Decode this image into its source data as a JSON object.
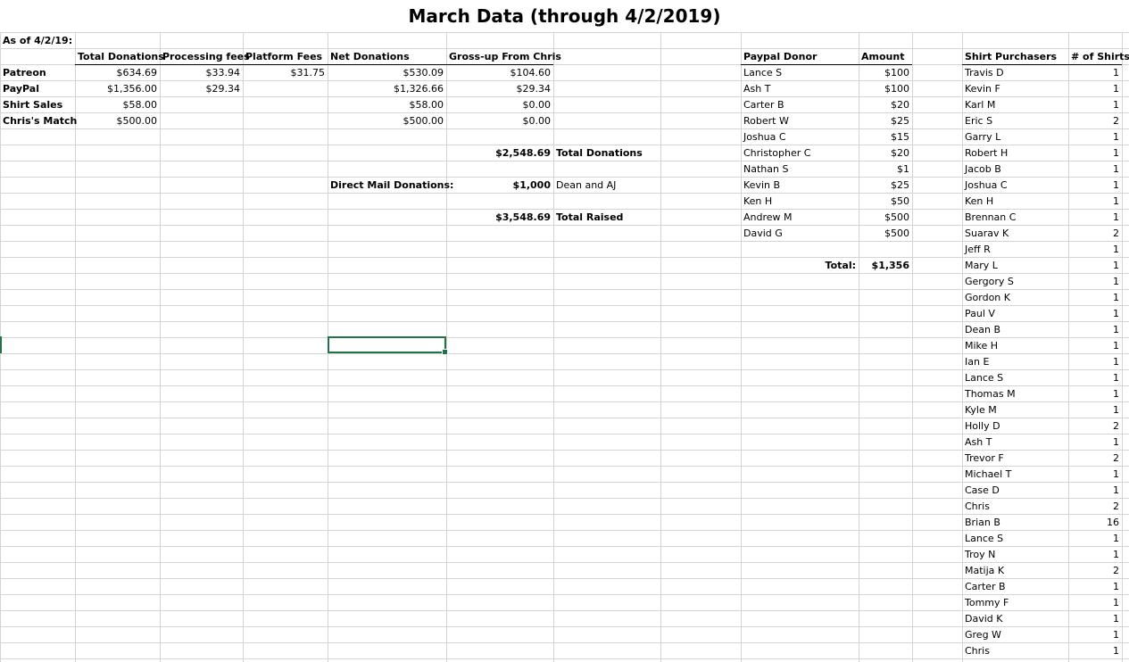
{
  "title": "March Data (through 4/2/2019)",
  "as_of": "As of 4/2/19:",
  "summary": {
    "headers": [
      "Total Donations",
      "Processing fees",
      "Platform Fees",
      "Net Donations",
      "Gross-up From Chris"
    ],
    "rows": [
      {
        "label": "Patreon",
        "total": "$634.69",
        "processing": "$33.94",
        "platform": "$31.75",
        "net": "$530.09",
        "grossup": "$104.60"
      },
      {
        "label": "PayPal",
        "total": "$1,356.00",
        "processing": "$29.34",
        "platform": "",
        "net": "$1,326.66",
        "grossup": "$29.34"
      },
      {
        "label": "Shirt Sales",
        "total": "$58.00",
        "processing": "",
        "platform": "",
        "net": "$58.00",
        "grossup": "$0.00"
      },
      {
        "label": "Chris's Match",
        "total": "$500.00",
        "processing": "",
        "platform": "",
        "net": "$500.00",
        "grossup": "$0.00"
      }
    ],
    "total_donations_value": "$2,548.69",
    "total_donations_label": "Total Donations",
    "direct_mail_label": "Direct Mail Donations:",
    "direct_mail_value": "$1,000",
    "direct_mail_note": "Dean and AJ",
    "total_raised_value": "$3,548.69",
    "total_raised_label": "Total Raised"
  },
  "paypal": {
    "header_donor": "Paypal Donor",
    "header_amount": "Amount",
    "donors": [
      {
        "name": "Lance S",
        "amount": "$100"
      },
      {
        "name": "Ash T",
        "amount": "$100"
      },
      {
        "name": "Carter B",
        "amount": "$20"
      },
      {
        "name": "Robert W",
        "amount": "$25"
      },
      {
        "name": "Joshua C",
        "amount": "$15"
      },
      {
        "name": "Christopher C",
        "amount": "$20"
      },
      {
        "name": "Nathan S",
        "amount": "$1"
      },
      {
        "name": "Kevin B",
        "amount": "$25"
      },
      {
        "name": "Ken H",
        "amount": "$50"
      },
      {
        "name": "Andrew M",
        "amount": "$500"
      },
      {
        "name": "David G",
        "amount": "$500"
      }
    ],
    "total_label": "Total:",
    "total_value": "$1,356"
  },
  "shirts": {
    "header_name": "Shirt Purchasers",
    "header_count": "# of Shirts",
    "purchasers": [
      {
        "name": "Travis D",
        "count": "1"
      },
      {
        "name": "Kevin F",
        "count": "1"
      },
      {
        "name": "Karl M",
        "count": "1"
      },
      {
        "name": "Eric S",
        "count": "2"
      },
      {
        "name": "Garry L",
        "count": "1"
      },
      {
        "name": "Robert H",
        "count": "1"
      },
      {
        "name": "Jacob B",
        "count": "1"
      },
      {
        "name": "Joshua C",
        "count": "1"
      },
      {
        "name": "Ken H",
        "count": "1"
      },
      {
        "name": "Brennan C",
        "count": "1"
      },
      {
        "name": "Suarav K",
        "count": "2"
      },
      {
        "name": "Jeff R",
        "count": "1"
      },
      {
        "name": "Mary L",
        "count": "1"
      },
      {
        "name": "Gergory S",
        "count": "1"
      },
      {
        "name": "Gordon K",
        "count": "1"
      },
      {
        "name": "Paul V",
        "count": "1"
      },
      {
        "name": "Dean B",
        "count": "1"
      },
      {
        "name": "Mike H",
        "count": "1"
      },
      {
        "name": "Ian E",
        "count": "1"
      },
      {
        "name": "Lance S",
        "count": "1"
      },
      {
        "name": "Thomas M",
        "count": "1"
      },
      {
        "name": "Kyle M",
        "count": "1"
      },
      {
        "name": "Holly D",
        "count": "2"
      },
      {
        "name": "Ash T",
        "count": "1"
      },
      {
        "name": "Trevor F",
        "count": "2"
      },
      {
        "name": "Michael T",
        "count": "1"
      },
      {
        "name": "Case D",
        "count": "1"
      },
      {
        "name": "Chris",
        "count": "2"
      },
      {
        "name": "Brian B",
        "count": "16"
      },
      {
        "name": "Lance S",
        "count": "1"
      },
      {
        "name": "Troy N",
        "count": "1"
      },
      {
        "name": "Matija K",
        "count": "2"
      },
      {
        "name": "Carter B",
        "count": "1"
      },
      {
        "name": "Tommy F",
        "count": "1"
      },
      {
        "name": "David K",
        "count": "1"
      },
      {
        "name": "Greg W",
        "count": "1"
      },
      {
        "name": "Chris",
        "count": "1"
      }
    ]
  }
}
